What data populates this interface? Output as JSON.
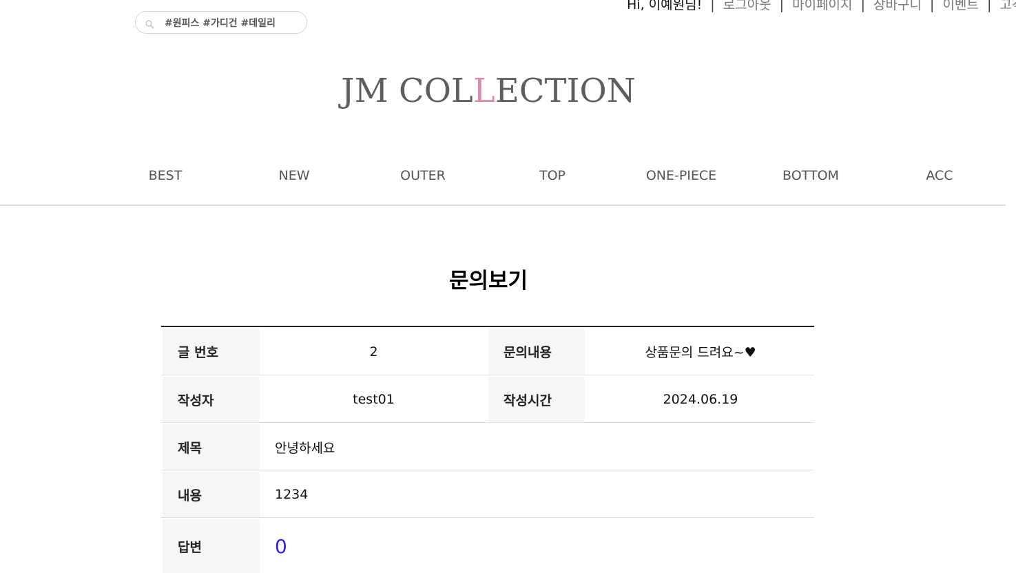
{
  "header": {
    "greeting": "Hi, 이예원님!",
    "separator": "|",
    "links": [
      "로그아웃",
      "마이페이지",
      "장바구니",
      "이벤트",
      "고객"
    ],
    "search_placeholder": "#원피스 #가디건 #데일리",
    "logo_prefix": "JM COL",
    "logo_accent": "L",
    "logo_suffix": "ECTION"
  },
  "nav": {
    "items": [
      "BEST",
      "NEW",
      "OUTER",
      "TOP",
      "ONE-PIECE",
      "BOTTOM",
      "ACC"
    ]
  },
  "page": {
    "title": "문의보기"
  },
  "inquiry": {
    "no_label": "글 번호",
    "no_value": "2",
    "type_label": "문의내용",
    "type_value": "상품문의 드려요~♥",
    "writer_label": "작성자",
    "writer_value": "test01",
    "time_label": "작성시간",
    "time_value": "2024.06.19",
    "subject_label": "제목",
    "subject_value": "안녕하세요",
    "content_label": "내용",
    "content_value": "1234",
    "answer_label": "답변",
    "answer_value": "0"
  },
  "colors": {
    "logo": "#5e5e5e",
    "logo_accent": "#d98cb0",
    "answer": "#2f1ff0",
    "header_cell_bg": "#f6f6f6"
  }
}
